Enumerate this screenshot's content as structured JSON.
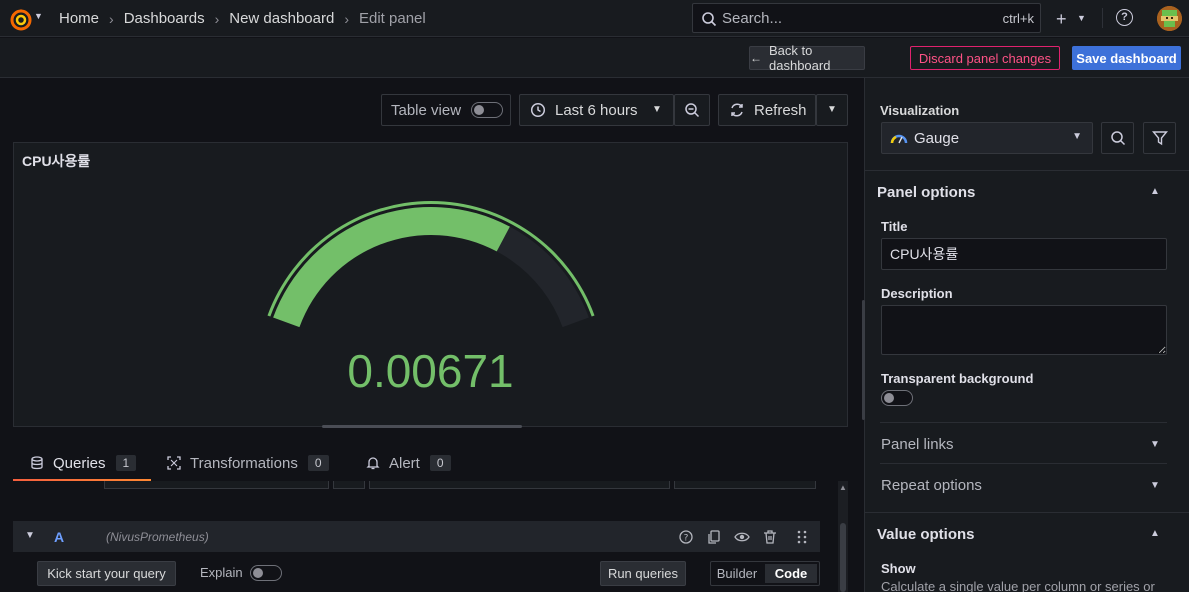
{
  "topbar": {
    "breadcrumbs": [
      "Home",
      "Dashboards",
      "New dashboard",
      "Edit panel"
    ],
    "search_placeholder": "Search...",
    "search_shortcut": "ctrl+k"
  },
  "actions": {
    "back": "Back to dashboard",
    "discard": "Discard panel changes",
    "save": "Save dashboard"
  },
  "toolbar": {
    "table_view": "Table view",
    "time_range": "Last 6 hours",
    "refresh": "Refresh"
  },
  "panel": {
    "title": "CPU사용률",
    "value": "0.00671",
    "gauge_fill_fraction": 0.7,
    "gauge_color": "#73bf69"
  },
  "tabs": [
    {
      "label": "Queries",
      "count": "1"
    },
    {
      "label": "Transformations",
      "count": "0"
    },
    {
      "label": "Alert",
      "count": "0"
    }
  ],
  "query": {
    "ref_id": "A",
    "datasource": "(NivusPrometheus)",
    "kick_start": "Kick start your query",
    "explain": "Explain",
    "run": "Run queries",
    "mode_builder": "Builder",
    "mode_code": "Code",
    "mode_selected": "Code"
  },
  "options": {
    "visualization_label": "Visualization",
    "visualization": "Gauge",
    "panel_options": "Panel options",
    "title_label": "Title",
    "title_value": "CPU사용률",
    "description_label": "Description",
    "description_value": "",
    "transparent_label": "Transparent background",
    "panel_links": "Panel links",
    "repeat_options": "Repeat options",
    "value_options": "Value options",
    "show_label": "Show",
    "show_desc": "Calculate a single value per column or series or"
  },
  "colors": {
    "accent": "#3d71d9",
    "danger": "#ff5286",
    "gauge_green": "#73bf69"
  }
}
